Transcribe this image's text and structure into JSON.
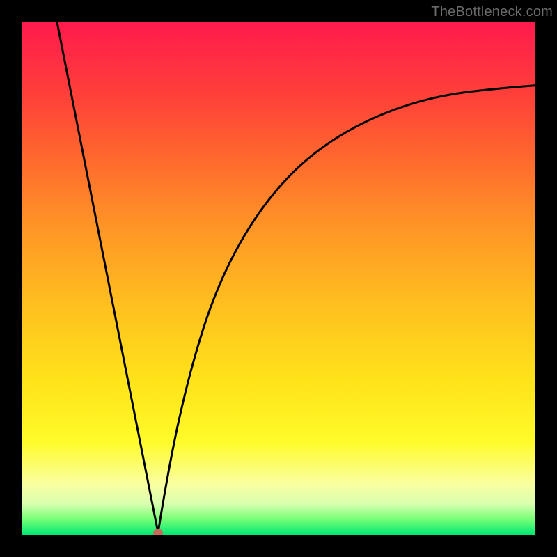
{
  "watermark": "TheBottleneck.com",
  "chart_data": {
    "type": "line",
    "title": "",
    "xlabel": "",
    "ylabel": "",
    "xlim": [
      0,
      100
    ],
    "ylim": [
      0,
      100
    ],
    "grid": false,
    "legend": false,
    "background_gradient": {
      "top": "#ff1a4d",
      "mid": "#ffe31a",
      "bottom": "#00e874",
      "meaning": "red=high bottleneck, green=low bottleneck"
    },
    "series": [
      {
        "name": "left-branch",
        "x": [
          6.5,
          26.5
        ],
        "y": [
          101,
          0.4
        ]
      },
      {
        "name": "right-branch",
        "x": [
          26.5,
          30,
          35,
          40,
          45,
          50,
          55,
          60,
          65,
          70,
          75,
          80,
          85,
          90,
          95,
          100
        ],
        "y": [
          0.4,
          15,
          29,
          40,
          50,
          58,
          65,
          71,
          76,
          80,
          83,
          85,
          86.5,
          87.5,
          88,
          88.5
        ]
      }
    ],
    "marker": {
      "x": 26.5,
      "y": 0.4,
      "color": "#c66b5a",
      "meaning": "minimum / balance point"
    }
  }
}
